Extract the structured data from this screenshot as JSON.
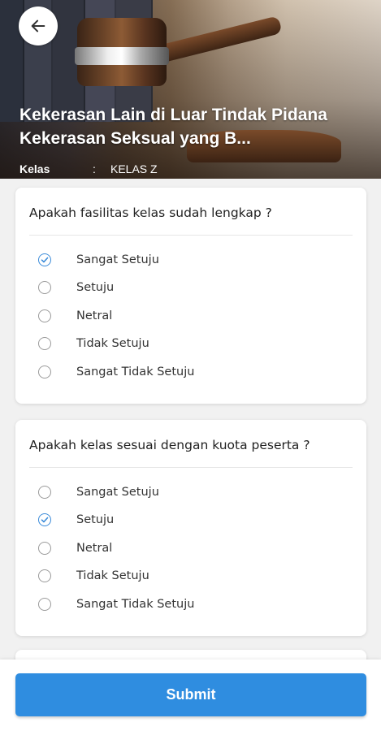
{
  "header": {
    "title": "Kekerasan Lain di Luar Tindak Pidana Kekerasan Seksual yang B...",
    "kelas_label": "Kelas",
    "kelas_separator": ":",
    "kelas_value": "KELAS Z"
  },
  "questions": [
    {
      "text": "Apakah fasilitas kelas sudah lengkap ?",
      "options": [
        "Sangat Setuju",
        "Setuju",
        "Netral",
        "Tidak Setuju",
        "Sangat Tidak Setuju"
      ],
      "selected": "Sangat Setuju"
    },
    {
      "text": "Apakah kelas sesuai dengan kuota peserta ?",
      "options": [
        "Sangat Setuju",
        "Setuju",
        "Netral",
        "Tidak Setuju",
        "Sangat Tidak Setuju"
      ],
      "selected": "Setuju"
    }
  ],
  "footer": {
    "submit_label": "Submit"
  },
  "colors": {
    "accent": "#2f8de0",
    "check": "#3b8bd9"
  },
  "icons": {
    "back": "arrow-left-icon",
    "selected": "check-icon"
  }
}
